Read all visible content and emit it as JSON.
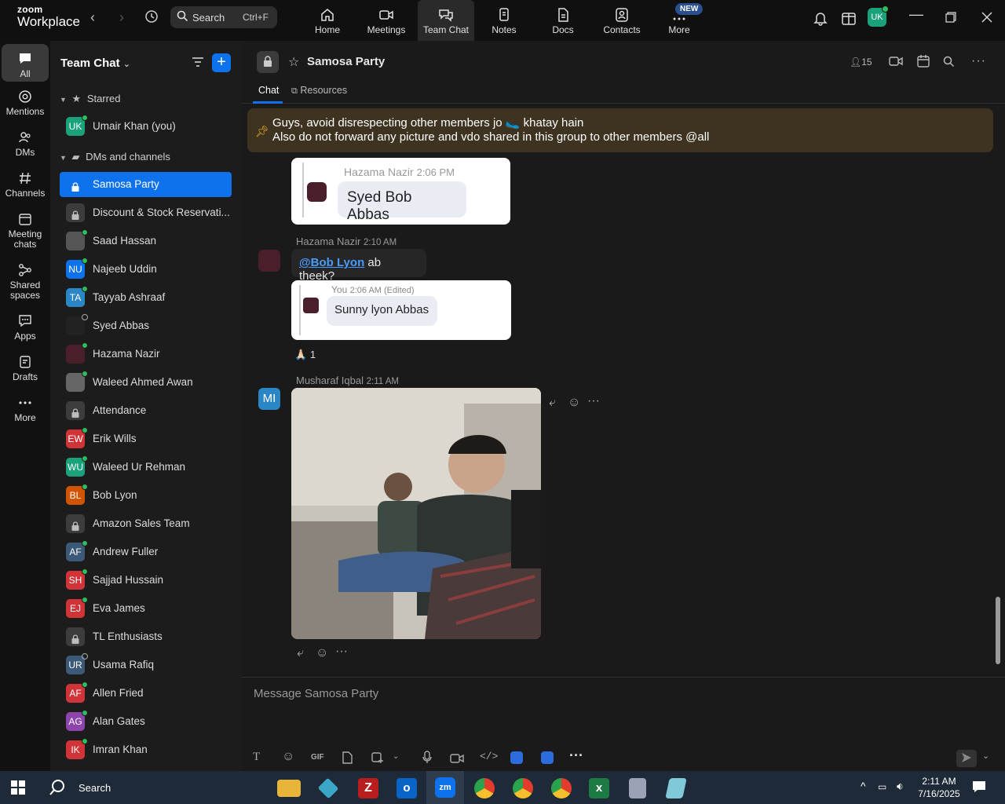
{
  "app": {
    "brand_top": "zoom",
    "brand_bottom": "Workplace"
  },
  "search": {
    "label": "Search",
    "shortcut": "Ctrl+F"
  },
  "topnav": [
    {
      "label": "Home",
      "icon": "home-icon"
    },
    {
      "label": "Meetings",
      "icon": "video-icon"
    },
    {
      "label": "Team Chat",
      "icon": "chat-icon"
    },
    {
      "label": "Notes",
      "icon": "notes-icon"
    },
    {
      "label": "Docs",
      "icon": "docs-icon"
    },
    {
      "label": "Contacts",
      "icon": "contacts-icon"
    },
    {
      "label": "More",
      "icon": "more-icon"
    }
  ],
  "new_badge": "NEW",
  "profile_initials": "UK",
  "rail": [
    {
      "label": "All"
    },
    {
      "label": "Mentions"
    },
    {
      "label": "DMs"
    },
    {
      "label": "Channels"
    },
    {
      "label": "Meeting chats"
    },
    {
      "label": "Shared spaces"
    },
    {
      "label": "Apps"
    },
    {
      "label": "Drafts"
    },
    {
      "label": "More"
    }
  ],
  "sidebar": {
    "title": "Team Chat",
    "starred_label": "Starred",
    "dms_label": "DMs and channels",
    "starred": [
      {
        "label": "Umair Khan (you)",
        "initials": "UK",
        "color": "#1aa37a",
        "online": true
      }
    ],
    "items": [
      {
        "label": "Samosa Party",
        "type": "channel"
      },
      {
        "label": "Discount & Stock Reservati...",
        "type": "lock"
      },
      {
        "label": "Saad Hassan",
        "type": "photo",
        "color": "#555",
        "online": true
      },
      {
        "label": "Najeeb Uddin",
        "initials": "NU",
        "color": "#0e72ed",
        "online": true
      },
      {
        "label": "Tayyab Ashraaf",
        "initials": "TA",
        "color": "#2b86c5",
        "online": true
      },
      {
        "label": "Syed Abbas",
        "type": "photo",
        "color": "#222",
        "online": false
      },
      {
        "label": "Hazama Nazir",
        "type": "photo",
        "color": "#4a1f2b",
        "online": true
      },
      {
        "label": "Waleed Ahmed Awan",
        "type": "photo",
        "color": "#666",
        "online": true
      },
      {
        "label": "Attendance",
        "type": "lock"
      },
      {
        "label": "Erik Wills",
        "initials": "EW",
        "color": "#d13438",
        "online": true
      },
      {
        "label": "Waleed Ur Rehman",
        "initials": "WU",
        "color": "#1aa37a",
        "online": true
      },
      {
        "label": "Bob Lyon",
        "initials": "BL",
        "color": "#d35400",
        "online": true
      },
      {
        "label": "Amazon Sales Team",
        "type": "lock"
      },
      {
        "label": "Andrew Fuller",
        "initials": "AF",
        "color": "#3c5a78",
        "online": true
      },
      {
        "label": "Sajjad Hussain",
        "initials": "SH",
        "color": "#d13438",
        "online": true
      },
      {
        "label": "Eva James",
        "initials": "EJ",
        "color": "#d13438",
        "online": true
      },
      {
        "label": "TL Enthusiasts",
        "type": "lock"
      },
      {
        "label": "Usama Rafiq",
        "initials": "UR",
        "color": "#3c5a78",
        "online": false
      },
      {
        "label": "Allen Fried",
        "initials": "AF",
        "color": "#d13438",
        "online": true
      },
      {
        "label": "Alan Gates",
        "initials": "AG",
        "color": "#8e44ad",
        "online": true
      },
      {
        "label": "Imran Khan",
        "initials": "IK",
        "color": "#d13438",
        "online": true
      }
    ]
  },
  "channel": {
    "name": "Samosa Party",
    "member_count": "15",
    "tabs": [
      {
        "label": "Chat"
      },
      {
        "label": "Resources"
      }
    ],
    "pinned_line1": "Guys, avoid disrespecting other members jo 🥿 khatay hain",
    "pinned_line2": "Also do not forward any picture and vdo shared in this group to other members @all"
  },
  "messages": {
    "quote1_author": "Hazama Nazir",
    "quote1_time": "2:06 PM",
    "quote1_text": "Syed Bob Abbas",
    "msg2_author": "Hazama Nazir",
    "msg2_time": "2:10 AM",
    "msg2_mention": "@Bob Lyon",
    "msg2_text": "ab theek?",
    "quote2_author": "You",
    "quote2_time": "2:06 AM (Edited)",
    "quote2_text": "Sunny lyon Abbas",
    "reaction_emoji": "🙏🏻",
    "reaction_count": "1",
    "msg3_author": "Musharaf Iqbal",
    "msg3_time": "2:11 AM",
    "msg3_initials": "MI"
  },
  "composer": {
    "placeholder": "Message Samosa Party",
    "gif": "GIF"
  },
  "taskbar": {
    "search": "Search",
    "time": "2:11 AM",
    "date": "7/16/2025"
  }
}
